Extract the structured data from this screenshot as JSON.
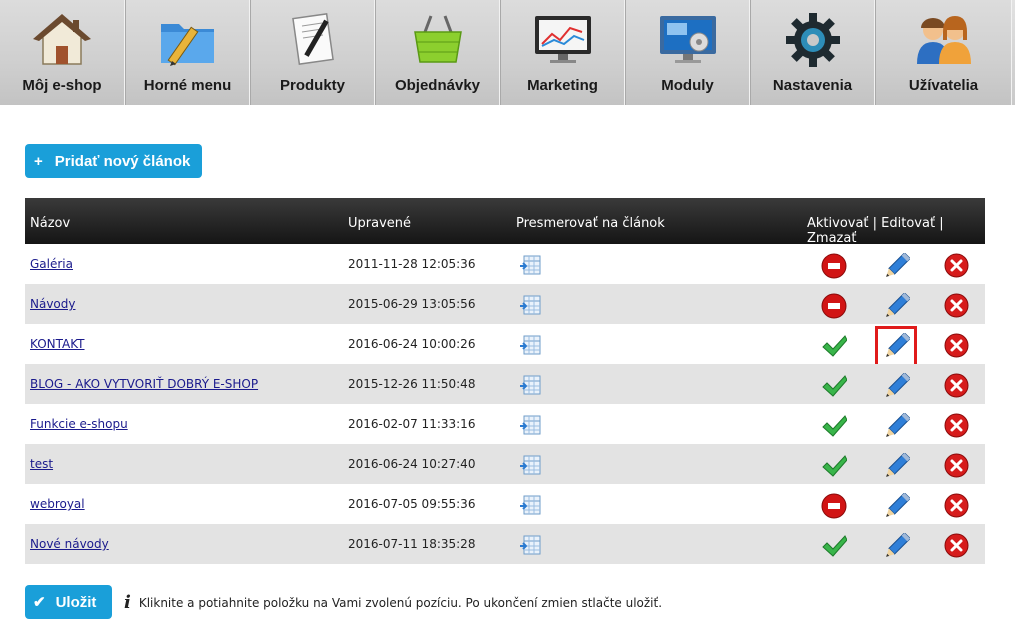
{
  "nav": [
    {
      "label": "Môj e-shop",
      "icon": "house-icon"
    },
    {
      "label": "Horné menu",
      "icon": "folder-pencil-icon"
    },
    {
      "label": "Produkty",
      "icon": "document-pen-icon"
    },
    {
      "label": "Objednávky",
      "icon": "basket-icon"
    },
    {
      "label": "Marketing",
      "icon": "monitor-chart-icon"
    },
    {
      "label": "Moduly",
      "icon": "monitor-gears-icon"
    },
    {
      "label": "Nastavenia",
      "icon": "gear-icon"
    },
    {
      "label": "Užívatelia",
      "icon": "users-icon"
    }
  ],
  "add_button": {
    "label": "Pridať nový článok",
    "icon": "+"
  },
  "table": {
    "headers": {
      "name": "Názov",
      "updated": "Upravené",
      "redirect": "Presmerovať na článok",
      "actions": "Aktivovať | Editovať | Zmazať"
    },
    "rows": [
      {
        "name": "Galéria",
        "date": "2011-11-28 12:05:36",
        "active": false
      },
      {
        "name": "Návody",
        "date": "2015-06-29 13:05:56",
        "active": false
      },
      {
        "name": "KONTAKT",
        "date": "2016-06-24 10:00:26",
        "active": true
      },
      {
        "name": "BLOG - AKO VYTVORIŤ DOBRÝ E-SHOP",
        "date": "2015-12-26 11:50:48",
        "active": true
      },
      {
        "name": "Funkcie e-shopu",
        "date": "2016-02-07 11:33:16",
        "active": true
      },
      {
        "name": "test",
        "date": "2016-06-24 10:27:40",
        "active": true
      },
      {
        "name": "webroyal",
        "date": "2016-07-05 09:55:36",
        "active": false
      },
      {
        "name": "Nové návody",
        "date": "2016-07-11 18:35:28",
        "active": true
      }
    ]
  },
  "save_button": {
    "label": "Uložit"
  },
  "info_text": "Kliknite a potiahnite položku na Vami zvolenú pozíciu. Po ukončení zmien stlačte uložiť.",
  "colors": {
    "accent": "#1a9fd9",
    "highlight": "#e01b1b",
    "link": "#1a1a8c"
  }
}
